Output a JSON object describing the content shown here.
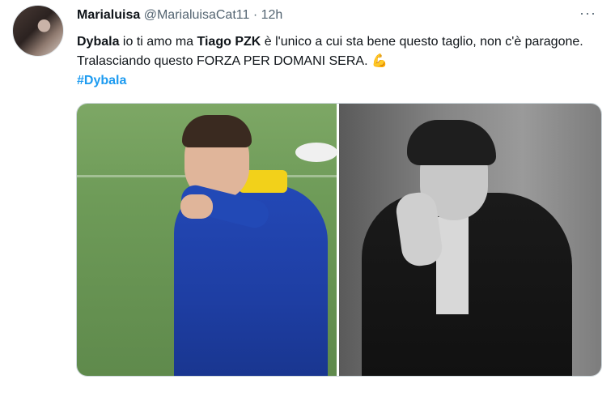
{
  "user": {
    "name": "Marialuisa",
    "handle": "@MarialuisaCat11",
    "separator": "·",
    "time": "12h",
    "more": "···"
  },
  "tweet": {
    "part1": "Dybala",
    "part2": " io ti amo ma ",
    "part3": "Tiago PZK",
    "part4": " è l'unico a cui sta bene questo taglio, non c'è paragone. Tralasciando questo FORZA PER DOMANI SERA. ",
    "emoji": "💪",
    "hashtag": "#Dybala"
  },
  "media": {
    "left_photo": "football-player-photo",
    "right_photo": "black-and-white-portrait-photo"
  }
}
